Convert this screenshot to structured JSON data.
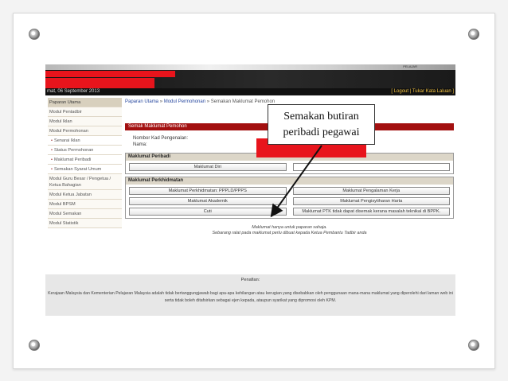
{
  "header": {
    "tag": "PELAJAR",
    "date": "mat, 06 September 2013",
    "links": "[ Logout | Tukar Kata Laluan ]"
  },
  "sidebar": {
    "items": [
      {
        "label": "Paparan Utama",
        "kind": "head"
      },
      {
        "label": "Modul Pentadbir",
        "kind": "item"
      },
      {
        "label": "Modul Iklan",
        "kind": "item"
      },
      {
        "label": "Modul Permohonan",
        "kind": "item"
      },
      {
        "label": "Senarai Iklan",
        "kind": "sub"
      },
      {
        "label": "Status Permohonan",
        "kind": "sub"
      },
      {
        "label": "Maklumat Peribadi",
        "kind": "sub"
      },
      {
        "label": "Semakan Syarat Umum",
        "kind": "sub"
      },
      {
        "label": "Modul Guru Besar / Pengetua / Ketua Bahagian",
        "kind": "tall"
      },
      {
        "label": "Modul Ketua Jabatan",
        "kind": "item"
      },
      {
        "label": "Modul BPSM",
        "kind": "item"
      },
      {
        "label": "Modul Semakan",
        "kind": "item"
      },
      {
        "label": "Modul Statistik",
        "kind": "item"
      }
    ]
  },
  "breadcrumb": {
    "home": "Paparan Utama",
    "sep1": " » ",
    "mod": "Modul Permohonan",
    "sep2": " » ",
    "current": "Semakan Maklumat Pemohon"
  },
  "panel": {
    "title": "Semak Maklumat Pemohon",
    "id_label": "Nombor Kad Pengenalan:",
    "name_label": "Nama:"
  },
  "section_peribadi": {
    "heading": "Maklumat Peribadi",
    "buttons": [
      "Maklumat Diri",
      ""
    ]
  },
  "section_perkhidmatan": {
    "heading": "Maklumat Perkhidmatan",
    "buttons": [
      "Maklumat Perkhidmatan: PPPLD/PPPS",
      "Maklumat Pengalaman Kerja",
      "Maklumat Akademik",
      "Maklumat Pengisytiharan Harta",
      "Cuti",
      "Maklumat PTK tidak dapat disemak kerana masalah teknikal di BPPK."
    ]
  },
  "notes": {
    "line1": "Maklumat hanya untuk paparan sahaja.",
    "line2": "Sebarang ralat pada maklumat perlu dibuat kepada Ketua Pembantu Tadbir anda"
  },
  "footer": {
    "title": "Penafian:",
    "body": "Kerajaan Malaysia dan Kementerian Pelajaran Malaysia adalah tidak bertanggungjawab bagi apa-apa kehilangan atau kerugian yang disebabkan oleh penggunaan mana-mana maklumat yang diperolehi dari laman web ini serta tidak boleh ditafsirkan sebagai ejen kepada, ataupun syarikat yang dipromosi oleh KPM."
  },
  "callout": {
    "line1": "Semakan butiran",
    "line2": "peribadi pegawai"
  },
  "colors": {
    "accent_red": "#a31010",
    "redaction_red": "#e8141c",
    "banner_dark": "#141414"
  }
}
